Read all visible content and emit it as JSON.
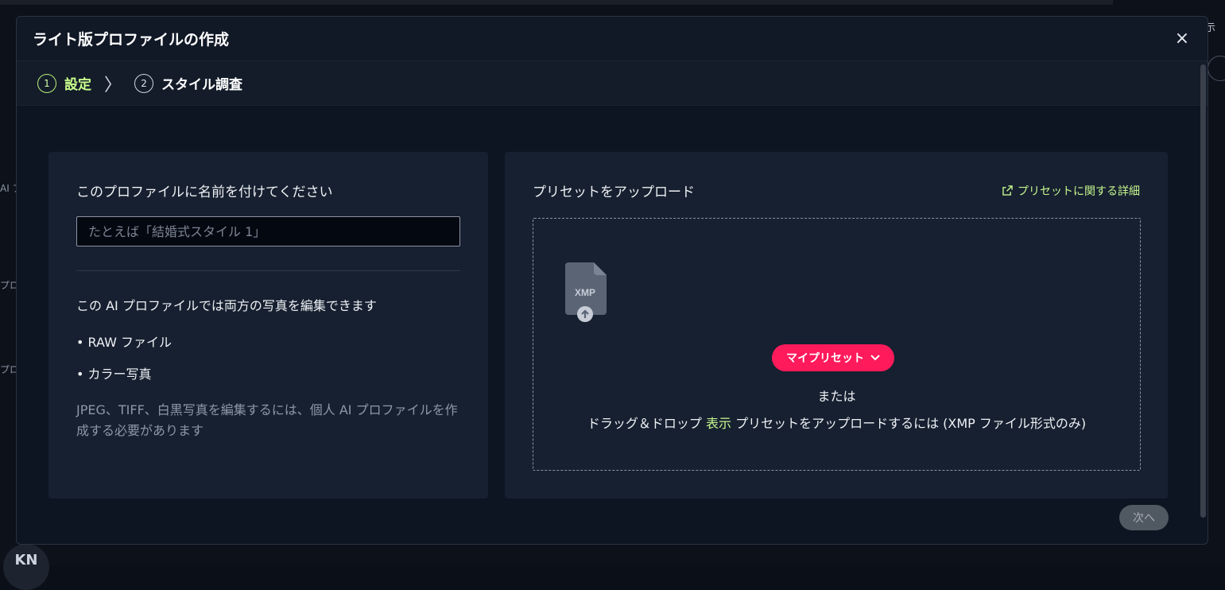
{
  "background": {
    "right_fragment": "示",
    "left_fragments": [
      "AI プ",
      "プロ",
      "プロフ"
    ],
    "avatar_initials": "KN"
  },
  "modal": {
    "title": "ライト版プロファイルの作成",
    "close_label": "×"
  },
  "stepper": {
    "steps": [
      {
        "number": "1",
        "label": "設定",
        "active": true
      },
      {
        "number": "2",
        "label": "スタイル調査",
        "active": false
      }
    ],
    "separator": "〉"
  },
  "left_card": {
    "name_label": "このプロファイルに名前を付けてください",
    "name_input": {
      "value": "",
      "placeholder": "たとえば「結婚式スタイル 1」"
    },
    "info_heading": "この AI プロファイルでは両方の写真を編集できます",
    "bullets": [
      "• RAW ファイル",
      "• カラー写真"
    ],
    "note": "JPEG、TIFF、白黒写真を編集するには、個人 AI プロファイルを作成する必要があります"
  },
  "right_card": {
    "upload_title": "プリセットをアップロード",
    "details_link": "プリセットに関する詳細",
    "xmp_icon_label": "XMP",
    "preset_button": "マイプリセット",
    "or_text": "または",
    "drop_text_before": "ドラッグ＆ドロップ",
    "browse_link": "表示",
    "drop_text_after": "プリセットをアップロードするには (XMP ファイル形式のみ)"
  },
  "footer": {
    "next_button": "次へ"
  },
  "colors": {
    "accent_green": "#c9ff8c",
    "preset_pink": "#ff1a5c",
    "modal_bg": "#0e1522",
    "card_bg": "#172030"
  },
  "icons": {
    "close": "close-icon",
    "external": "external-link-icon",
    "file": "xmp-file-upload-icon",
    "dropdown": "chevron-down-icon"
  }
}
